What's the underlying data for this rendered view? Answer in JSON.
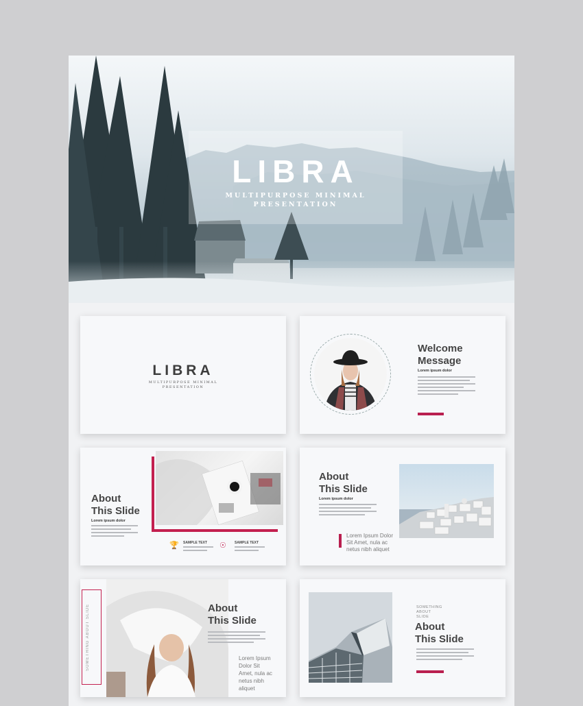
{
  "hero": {
    "title": "LIBRA",
    "subtitle": "MULTIPURPOSE MINIMAL PRESENTATION"
  },
  "slide1": {
    "title": "LIBRA",
    "subtitle": "MULTIPURPOSE MINIMAL PRESENTATION"
  },
  "slide2": {
    "heading_line1": "Welcome",
    "heading_line2": "Message",
    "caption": "Lorem ipsum dolor"
  },
  "slide3": {
    "heading_line1": "About",
    "heading_line2": "This Slide",
    "caption": "Lorem ipsum dolor",
    "sample_label_1": "SAMPLE TEXT",
    "sample_label_2": "SAMPLE TEXT",
    "trophy_icon": "trophy-icon",
    "award_icon": "award-icon"
  },
  "slide4": {
    "heading_line1": "About",
    "heading_line2": "This Slide",
    "caption": "Lorem ipsum dolor",
    "quote_line1": "Lorem Ipsum Dolor",
    "quote_line2": "Sit Amet, nula ac",
    "quote_line3": "netus nibh aliquet"
  },
  "slide5": {
    "side_label": "SOMETHING ABOUT SLIDE",
    "heading_line1": "About",
    "heading_line2": "This Slide",
    "quote_line1": "Lorem Ipsum",
    "quote_line2": "Dolor Sit",
    "quote_line3": "Amet, nula ac",
    "quote_line4": "netus nibh",
    "quote_line5": "aliquet"
  },
  "slide6": {
    "kicker_line1": "SOMETHING",
    "kicker_line2": "ABOUT",
    "kicker_line3": "SLIDE",
    "heading_line1": "About",
    "heading_line2": "This Slide"
  },
  "colors": {
    "accent": "#c3204f",
    "background": "#cfcfd1",
    "slide": "#f7f8fa"
  }
}
